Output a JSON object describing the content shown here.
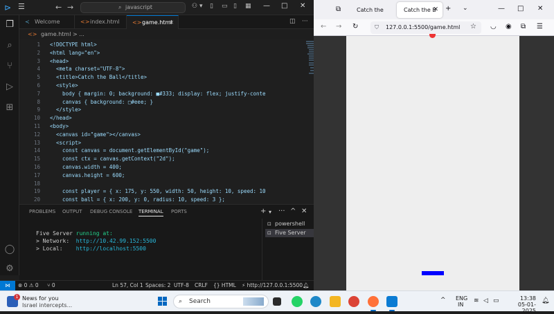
{
  "vscode": {
    "search_text": "javascript",
    "tabs": [
      {
        "label": "Welcome"
      },
      {
        "label": "index.html"
      },
      {
        "label": "game.html"
      }
    ],
    "breadcrumb": {
      "file": "game.html",
      "rest": "> ..."
    },
    "code_lines": [
      {
        "n": "1",
        "text": "<!DOCTYPE html>"
      },
      {
        "n": "2",
        "text": "<html lang=\"en\">"
      },
      {
        "n": "3",
        "text": "<head>"
      },
      {
        "n": "4",
        "text": "  <meta charset=\"UTF-8\">"
      },
      {
        "n": "5",
        "text": "  <title>Catch the Ball</title>"
      },
      {
        "n": "6",
        "text": "  <style>"
      },
      {
        "n": "7",
        "text": "    body { margin: 0; background: ■#333; display: flex; justify-conte"
      },
      {
        "n": "8",
        "text": "    canvas { background: □#eee; }"
      },
      {
        "n": "9",
        "text": "  </style>"
      },
      {
        "n": "10",
        "text": "</head>"
      },
      {
        "n": "11",
        "text": "<body>"
      },
      {
        "n": "12",
        "text": "  <canvas id=\"game\"></canvas>"
      },
      {
        "n": "13",
        "text": "  <script>"
      },
      {
        "n": "14",
        "text": "    const canvas = document.getElementById(\"game\");"
      },
      {
        "n": "15",
        "text": "    const ctx = canvas.getContext(\"2d\");"
      },
      {
        "n": "16",
        "text": "    canvas.width = 400;"
      },
      {
        "n": "17",
        "text": "    canvas.height = 600;"
      },
      {
        "n": "18",
        "text": ""
      },
      {
        "n": "19",
        "text": "    const player = { x: 175, y: 550, width: 50, height: 10, speed: 10"
      },
      {
        "n": "20",
        "text": "    const ball = { x: 200, y: 0, radius: 10, speed: 3 };"
      }
    ],
    "panel_tabs": [
      "PROBLEMS",
      "OUTPUT",
      "DEBUG CONSOLE",
      "TERMINAL",
      "PORTS"
    ],
    "terminal": {
      "line1_a": "Five Server ",
      "line1_b": "running at:",
      "line2_label": "> Network:  ",
      "line2_url": "http://10.42.99.152:5500",
      "line3_label": "> Local:    ",
      "line3_url": "http://localhost:5500"
    },
    "terminal_list": [
      "powershell",
      "Five Server"
    ],
    "status": {
      "problems": "⊗ 0 ⚠ 0",
      "ports": "⑂ 0",
      "position": "Ln 57, Col 1",
      "spaces": "Spaces: 2",
      "encoding": "UTF-8",
      "eol": "CRLF",
      "language": "{} HTML",
      "server": "⚡ http://127.0.0.1:5500"
    }
  },
  "browser": {
    "tabs": [
      {
        "label": "Catch the Ball"
      },
      {
        "label": "Catch the B"
      }
    ],
    "url": "127.0.0.1:5500/game.html"
  },
  "taskbar": {
    "news_title": "News for you",
    "news_sub": "Israel intercepts...",
    "news_badge": "1",
    "search_placeholder": "Search",
    "lang1": "ENG",
    "lang2": "IN",
    "time": "13:38",
    "date": "05-01-2025"
  }
}
